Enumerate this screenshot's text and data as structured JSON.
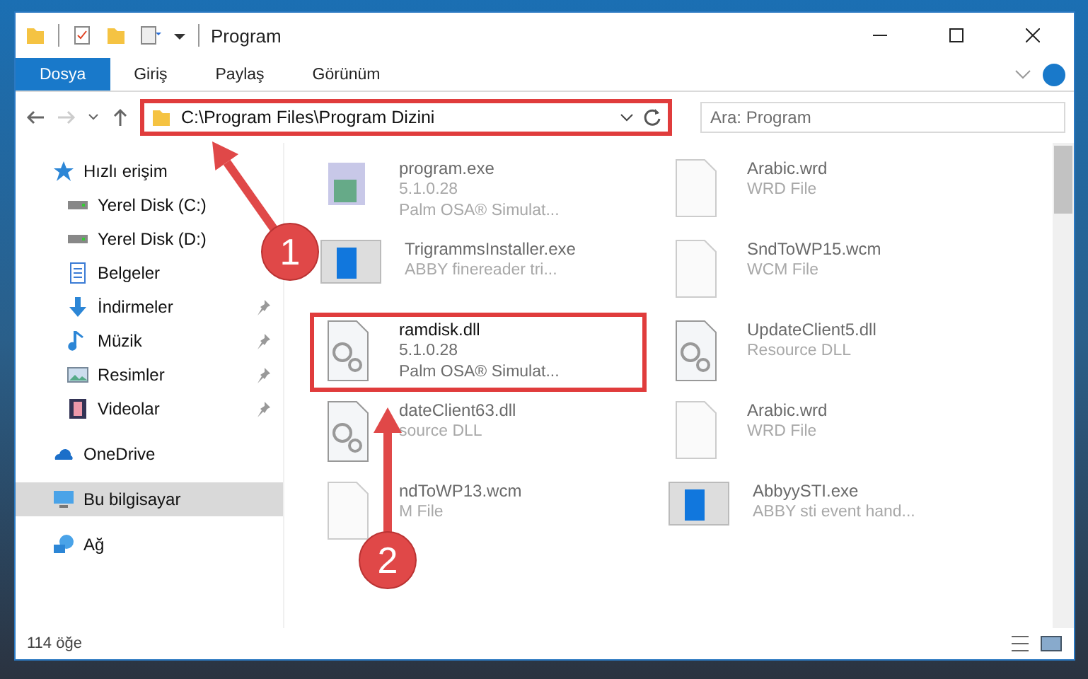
{
  "window": {
    "title": "Program"
  },
  "ribbon_tabs": [
    {
      "label": "Dosya",
      "kind": "file"
    },
    {
      "label": "Giriş",
      "kind": "tab"
    },
    {
      "label": "Paylaş",
      "kind": "tab"
    },
    {
      "label": "Görünüm",
      "kind": "tab"
    }
  ],
  "address": {
    "path": "C:\\Program Files\\Program Dizini",
    "highlighted": true
  },
  "search": {
    "placeholder": "Ara: Program"
  },
  "sidebar": {
    "items": [
      {
        "label": "Hızlı erişim",
        "kind": "star",
        "selected": false,
        "children": [
          {
            "label": "Yerel Disk (C:)",
            "kind": "drive",
            "pinned": false
          },
          {
            "label": "Yerel Disk (D:)",
            "kind": "drive",
            "pinned": false
          },
          {
            "label": "Belgeler",
            "kind": "document",
            "pinned": false
          },
          {
            "label": "İndirmeler",
            "kind": "download",
            "pinned": true
          },
          {
            "label": "Müzik",
            "kind": "music",
            "pinned": true
          },
          {
            "label": "Resimler",
            "kind": "picture",
            "pinned": true
          },
          {
            "label": "Videolar",
            "kind": "video",
            "pinned": true
          }
        ]
      },
      {
        "label": "OneDrive",
        "kind": "cloud",
        "selected": false
      },
      {
        "label": "Bu bilgisayar",
        "kind": "computer",
        "selected": true
      },
      {
        "label": "Ağ",
        "kind": "network",
        "selected": false
      }
    ]
  },
  "files": [
    {
      "name": "program.exe",
      "details": [
        "5.1.0.28",
        "Palm OSA® Simulat..."
      ],
      "kind": "exe",
      "highlighted": false
    },
    {
      "name": "Arabic.wrd",
      "details": [
        "WRD File"
      ],
      "kind": "blank",
      "highlighted": false
    },
    {
      "name": "TrigrammsInstaller.exe",
      "details": [
        "ABBY finereader tri..."
      ],
      "kind": "app",
      "highlighted": false
    },
    {
      "name": "SndToWP15.wcm",
      "details": [
        "WCM File"
      ],
      "kind": "blank",
      "highlighted": false
    },
    {
      "name": "ramdisk.dll",
      "details": [
        "5.1.0.28",
        "Palm OSA® Simulat..."
      ],
      "kind": "dll",
      "highlighted": true
    },
    {
      "name": "UpdateClient5.dll",
      "details": [
        "Resource DLL"
      ],
      "kind": "dll",
      "highlighted": false
    },
    {
      "name": "dateClient63.dll",
      "details": [
        "source DLL"
      ],
      "kind": "dll",
      "highlighted": false
    },
    {
      "name": "Arabic.wrd",
      "details": [
        "WRD File"
      ],
      "kind": "blank",
      "highlighted": false
    },
    {
      "name": "ndToWP13.wcm",
      "details": [
        "M File"
      ],
      "kind": "blank",
      "highlighted": false
    },
    {
      "name": "AbbyySTI.exe",
      "details": [
        "ABBY sti event hand..."
      ],
      "kind": "app",
      "highlighted": false
    }
  ],
  "status_bar": {
    "count": "114 öğe"
  },
  "callouts": [
    {
      "number": "1"
    },
    {
      "number": "2"
    }
  ]
}
